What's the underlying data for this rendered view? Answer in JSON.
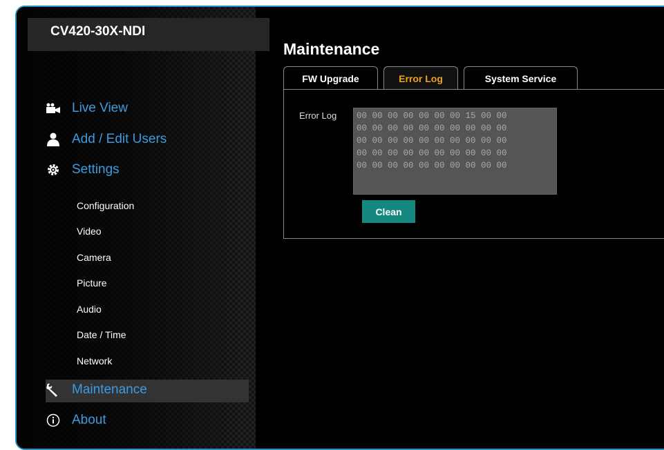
{
  "device": {
    "title": "CV420-30X-NDI"
  },
  "nav": {
    "main": [
      {
        "label": "Live View",
        "icon": "camera-icon"
      },
      {
        "label": "Add / Edit Users",
        "icon": "user-icon"
      },
      {
        "label": "Settings",
        "icon": "gear-icon"
      }
    ],
    "settings_sub": [
      "Configuration",
      "Video",
      "Camera",
      "Picture",
      "Audio",
      "Date / Time",
      "Network"
    ],
    "maintenance": {
      "label": "Maintenance",
      "icon": "wrench-icon",
      "active": true
    },
    "about": {
      "label": "About",
      "icon": "info-icon"
    }
  },
  "page": {
    "title": "Maintenance",
    "tabs": [
      {
        "label": "FW Upgrade",
        "active": false
      },
      {
        "label": "Error Log",
        "active": true
      },
      {
        "label": "System Service",
        "active": false
      }
    ],
    "error_log": {
      "label": "Error Log",
      "lines": [
        "00 00 00 00 00 00 00 15 00 00",
        "00 00 00 00 00 00 00 00 00 00",
        "00 00 00 00 00 00 00 00 00 00",
        "00 00 00 00 00 00 00 00 00 00",
        "00 00 00 00 00 00 00 00 00 00"
      ],
      "clean_label": "Clean"
    }
  },
  "colors": {
    "nav_text": "#3d9be0",
    "active_tab": "#f0a21a",
    "clean_button": "#15897f",
    "frame_border": "#2f8fc9"
  }
}
